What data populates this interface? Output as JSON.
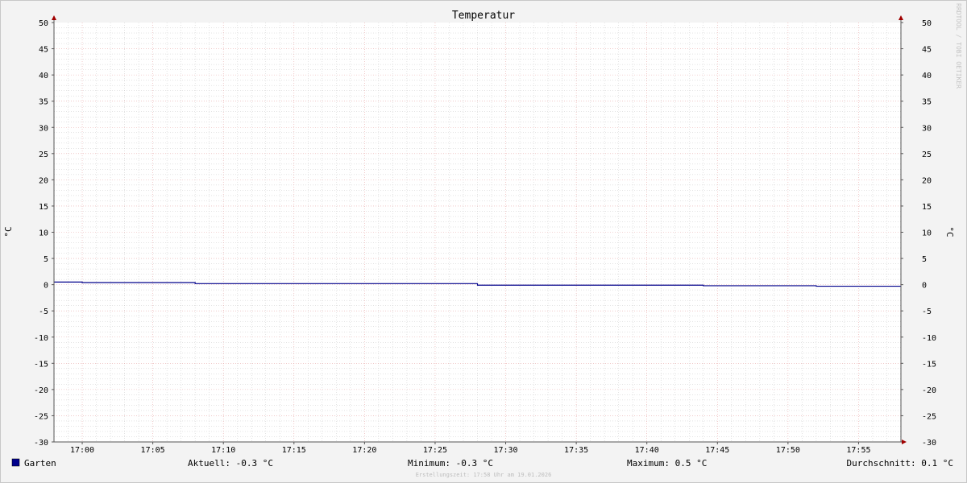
{
  "chart_data": {
    "type": "line",
    "title": "Temperatur",
    "ylabel": "°C",
    "ylabel_right": "°C",
    "ylim": [
      -30,
      50
    ],
    "y_ticks": [
      50,
      45,
      40,
      35,
      30,
      25,
      20,
      15,
      10,
      5,
      0,
      -5,
      -10,
      -15,
      -20,
      -25,
      -30
    ],
    "x_tick_labels": [
      "17:00",
      "17:05",
      "17:10",
      "17:15",
      "17:20",
      "17:25",
      "17:30",
      "17:35",
      "17:40",
      "17:45",
      "17:50",
      "17:55"
    ],
    "xlim": [
      "16:58",
      "17:58"
    ],
    "grid": true,
    "colors": {
      "series": "#00008b",
      "axis": "#555555",
      "arrow": "#a00000",
      "major_grid": "#e8a8a8",
      "minor_grid": "#c8c8c8",
      "plot_background": "#ffffff"
    },
    "series": [
      {
        "name": "Garten",
        "points": [
          [
            "16:58",
            0.5
          ],
          [
            "17:00",
            0.4
          ],
          [
            "17:08",
            0.2
          ],
          [
            "17:28",
            -0.1
          ],
          [
            "17:44",
            -0.2
          ],
          [
            "17:52",
            -0.3
          ],
          [
            "17:58",
            -0.3
          ]
        ]
      }
    ],
    "stats": {
      "current": "Aktuell: -0.3 °C",
      "minimum": "Minimum: -0.3 °C",
      "maximum": "Maximum: 0.5 °C",
      "average": "Durchschnitt: 0.1 °C"
    },
    "watermark": "RRDTOOL / TOBI OETIKER",
    "footer": "Erstellungszeit: 17:58 Uhr am 19.01.2026"
  }
}
